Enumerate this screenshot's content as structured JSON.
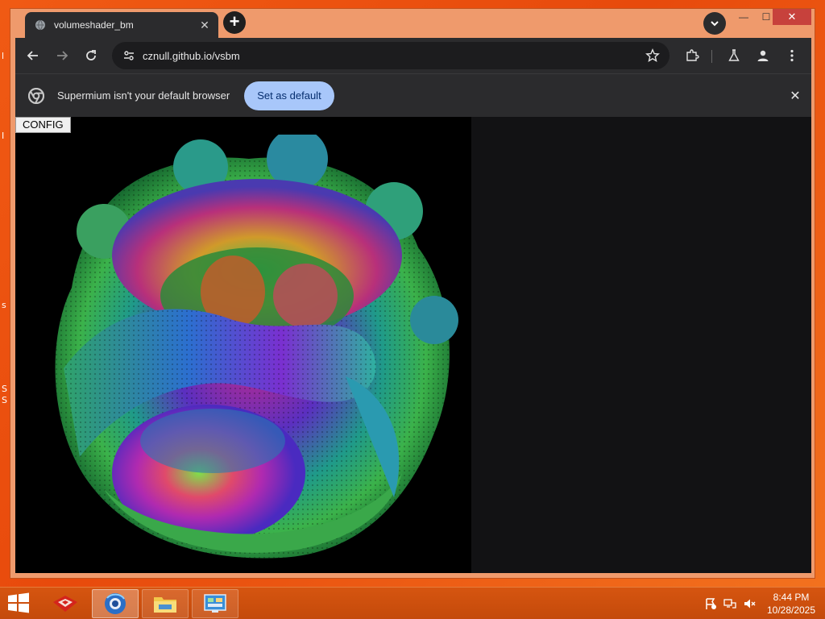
{
  "desktop": {
    "fragments": [
      "l",
      "I",
      "s",
      "S",
      "S"
    ]
  },
  "browser": {
    "tab": {
      "title": "volumeshader_bm",
      "close_label": "✕"
    },
    "new_tab_label": "+",
    "window_controls": {
      "minimize": "—",
      "maximize": "☐",
      "close": "✕"
    },
    "address": {
      "url": "cznull.github.io/vsbm"
    },
    "infobar": {
      "message": "Supermium isn't your default browser",
      "action": "Set as default",
      "close_label": "✕"
    }
  },
  "page": {
    "config_button": "CONFIG"
  },
  "taskbar": {
    "items": [
      "start-button",
      "app-red",
      "supermium",
      "file-explorer",
      "control-panel"
    ],
    "clock": {
      "time": "8:44 PM",
      "date": "10/28/2025"
    }
  },
  "colors": {
    "browser_chrome": "#2b2b2d",
    "accent_button": "#a8c7fa",
    "taskbar": "#c44a0b",
    "desktop": "#f05a14"
  }
}
